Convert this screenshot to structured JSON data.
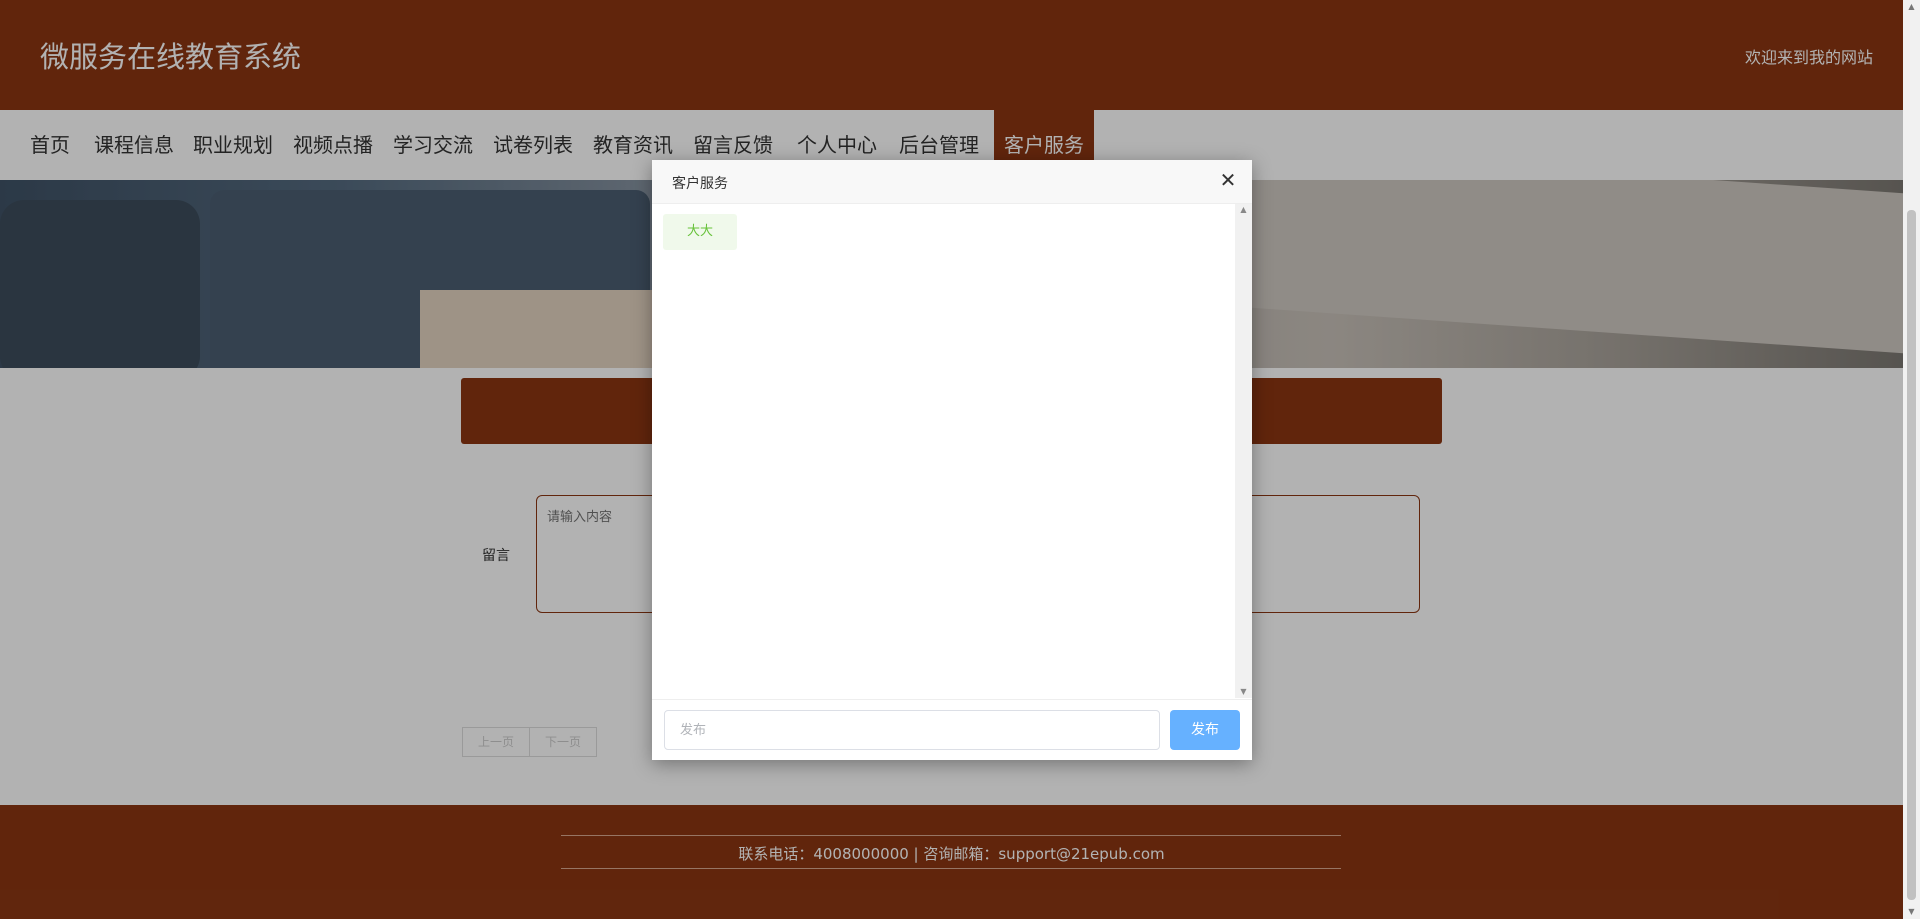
{
  "header": {
    "title": "微服务在线教育系统",
    "welcome": "欢迎来到我的网站"
  },
  "nav": {
    "items": [
      {
        "label": "首页"
      },
      {
        "label": "课程信息"
      },
      {
        "label": "职业规划"
      },
      {
        "label": "视频点播"
      },
      {
        "label": "学习交流"
      },
      {
        "label": "试卷列表"
      },
      {
        "label": "教育资讯"
      },
      {
        "label": "留言反馈"
      },
      {
        "label": "个人中心"
      },
      {
        "label": "后台管理"
      },
      {
        "label": "客户服务"
      }
    ],
    "active_index": 10
  },
  "form": {
    "message_label": "留言",
    "message_placeholder": "请输入内容"
  },
  "pager": {
    "prev_label": "上一页",
    "next_label": "下一页"
  },
  "footer": {
    "contact": "联系电话：4008000000 | 咨询邮箱：support@21epub.com"
  },
  "dialog": {
    "title": "客户服务",
    "messages": [
      {
        "text": "大大"
      }
    ],
    "input_placeholder": "发布",
    "publish_label": "发布"
  },
  "colors": {
    "brand": "#8b3612",
    "bubble_text": "#67c23a",
    "bubble_bg": "#f0f9eb",
    "publish_btn": "#66b1ff"
  }
}
